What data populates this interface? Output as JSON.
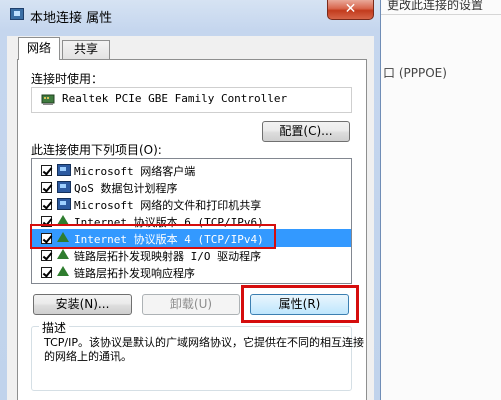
{
  "background": {
    "top_text": "更改此连接的设置",
    "pppoe_label": "口 (PPPOE)"
  },
  "dialog": {
    "title": "本地连接 属性",
    "close_label": "✕",
    "tabs": [
      {
        "label": "网络",
        "active": true
      },
      {
        "label": "共享",
        "active": false
      }
    ],
    "connect_using_label": "连接时使用：",
    "adapter_name": "Realtek PCIe GBE Family Controller",
    "configure_button": "配置(C)...",
    "items_label": "此连接使用下列项目(O):",
    "items": [
      {
        "label": "Microsoft 网络客户端",
        "checked": true,
        "icon": "network-client-icon"
      },
      {
        "label": "QoS 数据包计划程序",
        "checked": true,
        "icon": "qos-icon"
      },
      {
        "label": "Microsoft 网络的文件和打印机共享",
        "checked": true,
        "icon": "file-share-icon"
      },
      {
        "label": "Internet 协议版本 6 (TCP/IPv6)",
        "checked": true,
        "icon": "protocol-icon"
      },
      {
        "label": "Internet 协议版本 4 (TCP/IPv4)",
        "checked": true,
        "icon": "protocol-icon",
        "selected": true
      },
      {
        "label": "链路层拓扑发现映射器 I/O 驱动程序",
        "checked": true,
        "icon": "protocol-icon"
      },
      {
        "label": "链路层拓扑发现响应程序",
        "checked": true,
        "icon": "protocol-icon"
      }
    ],
    "install_button": "安装(N)...",
    "uninstall_button": "卸载(U)",
    "properties_button": "属性(R)",
    "description_title": "描述",
    "description_text": "TCP/IP。该协议是默认的广域网络协议，它提供在不同的相互连接的网络上的通讯。"
  },
  "colors": {
    "selection": "#3399ff",
    "highlight_box": "#d50d0d"
  }
}
